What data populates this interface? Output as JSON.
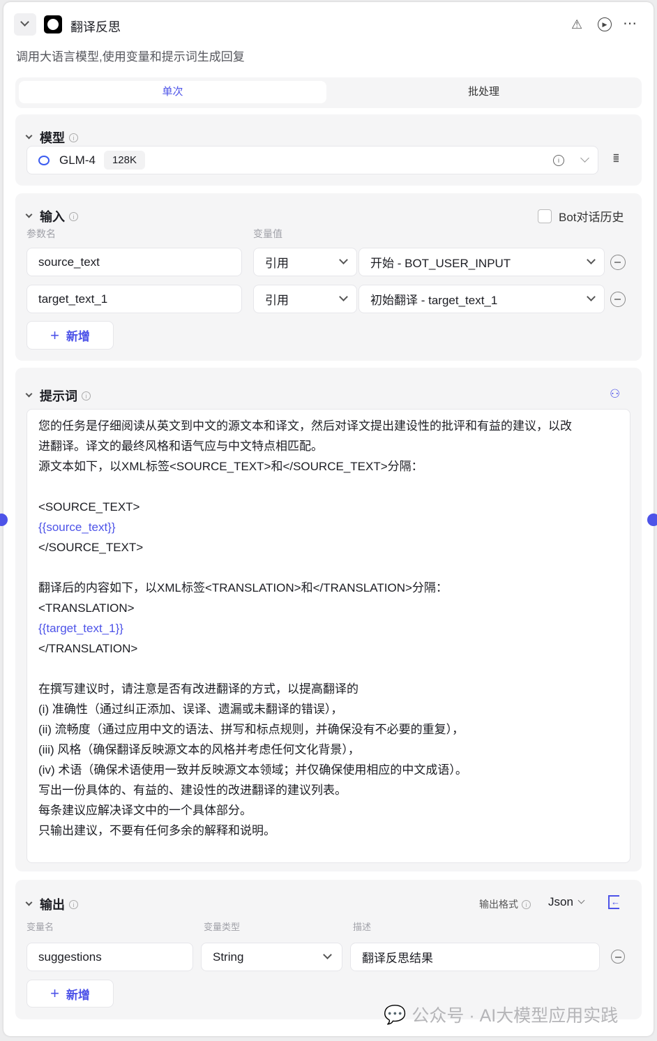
{
  "header": {
    "title": "翻译反思",
    "description": "调用大语言模型,使用变量和提示词生成回复"
  },
  "tabs": [
    {
      "label": "单次",
      "active": true
    },
    {
      "label": "批处理",
      "active": false
    }
  ],
  "model": {
    "title": "模型",
    "name": "GLM-4",
    "context": "128K"
  },
  "input": {
    "title": "输入",
    "history_label": "Bot对话历史",
    "col_name": "参数名",
    "col_value": "变量值",
    "rows": [
      {
        "name": "source_text",
        "type": "引用",
        "value": "开始 - BOT_USER_INPUT"
      },
      {
        "name": "target_text_1",
        "type": "引用",
        "value": "初始翻译 - target_text_1"
      }
    ],
    "add_label": "新增"
  },
  "prompt": {
    "title": "提示词",
    "lines": [
      {
        "t": "您的任务是仔细阅读从英文到中文的源文本和译文，然后对译文提出建设性的批评和有益的建议，以改"
      },
      {
        "t": "进翻译。译文的最终风格和语气应与中文特点相匹配。"
      },
      {
        "t": "源文本如下，以XML标签<SOURCE_TEXT>和</SOURCE_TEXT>分隔："
      },
      {
        "t": ""
      },
      {
        "t": "<SOURCE_TEXT>"
      },
      {
        "t": "{{source_text}}",
        "var": true
      },
      {
        "t": "</SOURCE_TEXT>"
      },
      {
        "t": ""
      },
      {
        "t": "翻译后的内容如下，以XML标签<TRANSLATION>和</TRANSLATION>分隔："
      },
      {
        "t": "<TRANSLATION>"
      },
      {
        "t": "{{target_text_1}}",
        "var": true
      },
      {
        "t": "</TRANSLATION>"
      },
      {
        "t": ""
      },
      {
        "t": "在撰写建议时，请注意是否有改进翻译的方式，以提高翻译的"
      },
      {
        "t": "(i) 准确性（通过纠正添加、误译、遗漏或未翻译的错误），"
      },
      {
        "t": "(ii) 流畅度（通过应用中文的语法、拼写和标点规则，并确保没有不必要的重复），"
      },
      {
        "t": "(iii) 风格（确保翻译反映源文本的风格并考虑任何文化背景），"
      },
      {
        "t": "(iv) 术语（确保术语使用一致并反映源文本领域；并仅确保使用相应的中文成语）。"
      },
      {
        "t": "写出一份具体的、有益的、建设性的改进翻译的建议列表。"
      },
      {
        "t": "每条建议应解决译文中的一个具体部分。"
      },
      {
        "t": "只输出建议，不要有任何多余的解释和说明。"
      }
    ]
  },
  "output": {
    "title": "输出",
    "format_label": "输出格式",
    "format_value": "Json",
    "col_name": "变量名",
    "col_type": "变量类型",
    "col_desc": "描述",
    "rows": [
      {
        "name": "suggestions",
        "type": "String",
        "desc": "翻译反思结果"
      }
    ],
    "add_label": "新增"
  },
  "watermark": "公众号 · AI大模型应用实践",
  "colors": {
    "accent": "#4d53e8"
  }
}
